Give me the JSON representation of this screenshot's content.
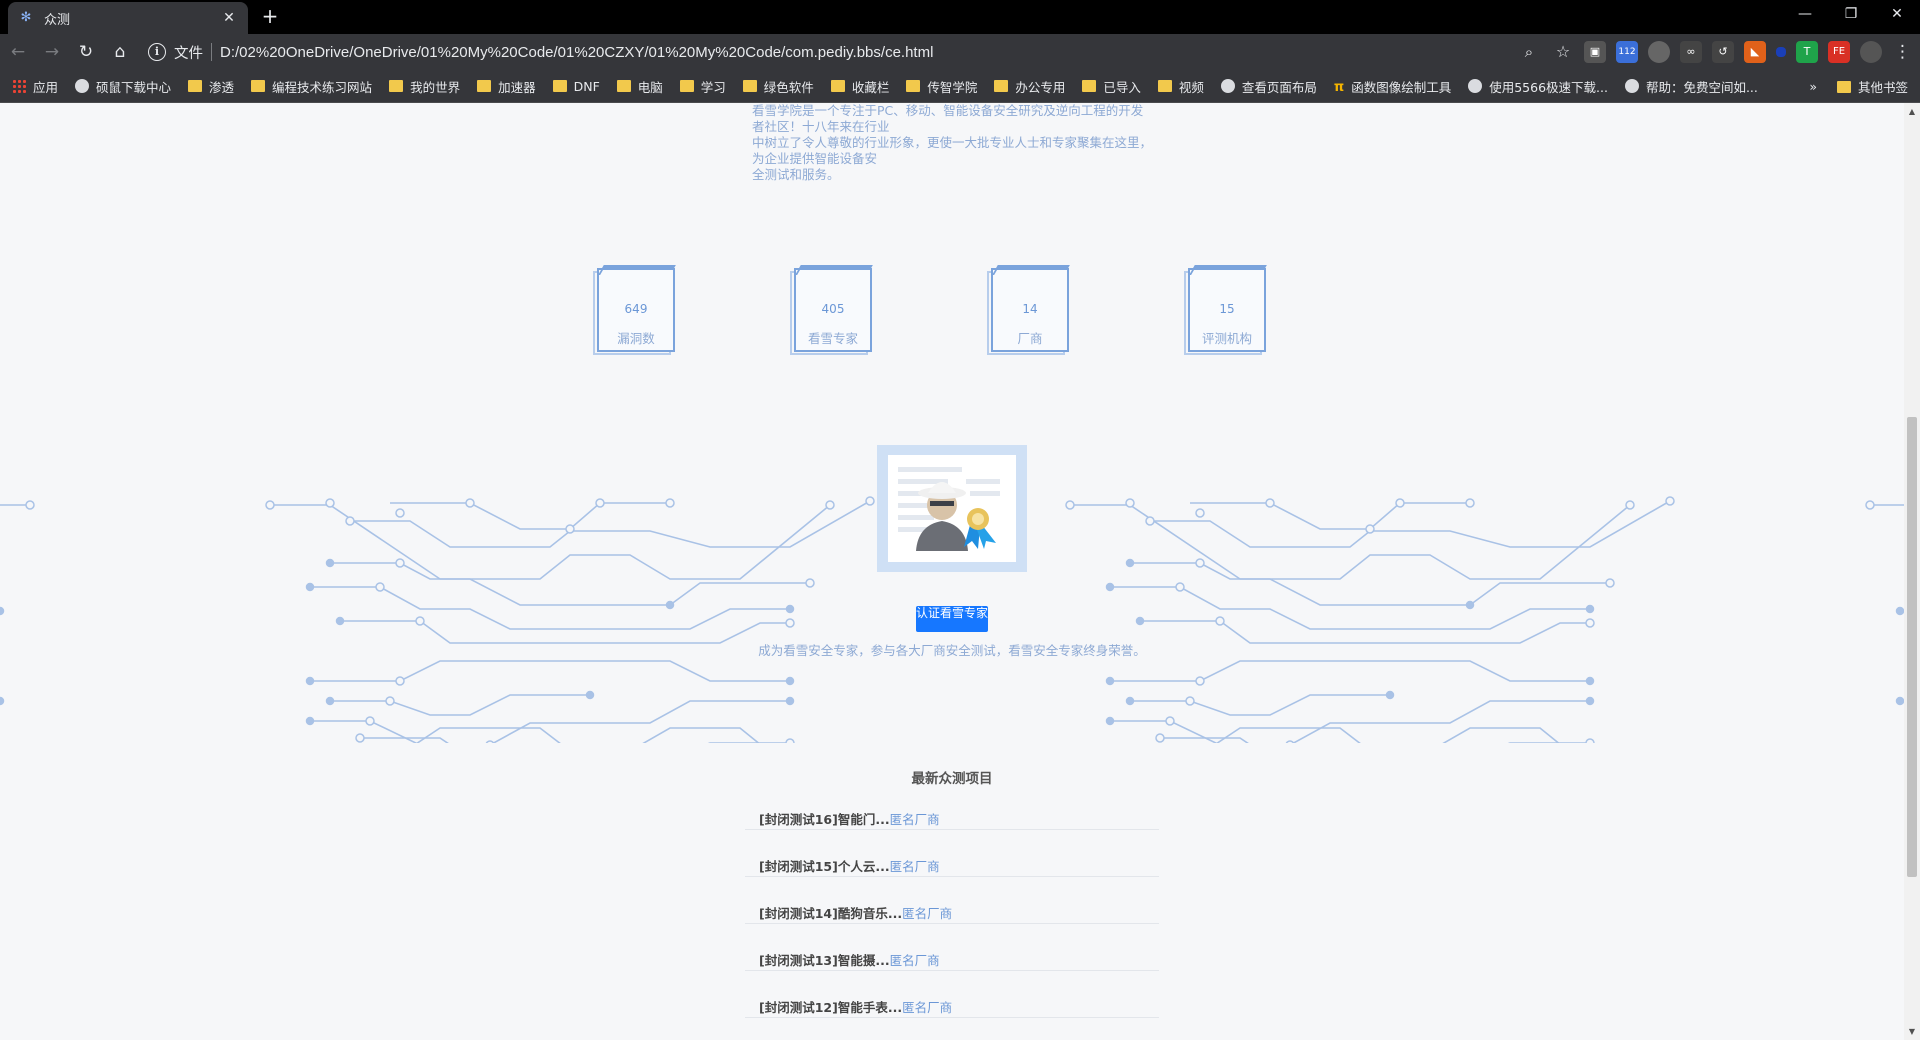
{
  "browser": {
    "tab_title": "众测",
    "scheme_label": "文件",
    "url": "D:/02%20OneDrive/OneDrive/01%20My%20Code/01%20CZXY/01%20My%20Code/com.pediy.bbs/ce.html",
    "extension_badge": "112",
    "ext_fe_label": "FE"
  },
  "bookmarks": [
    {
      "label": "应用",
      "icon": "apps-icon"
    },
    {
      "label": "硕鼠下载中心",
      "icon": "globe-icon"
    },
    {
      "label": "渗透",
      "icon": "folder-icon"
    },
    {
      "label": "编程技术练习网站",
      "icon": "folder-icon"
    },
    {
      "label": "我的世界",
      "icon": "folder-icon"
    },
    {
      "label": "加速器",
      "icon": "folder-icon"
    },
    {
      "label": "DNF",
      "icon": "folder-icon"
    },
    {
      "label": "电脑",
      "icon": "folder-icon"
    },
    {
      "label": "学习",
      "icon": "folder-icon"
    },
    {
      "label": "绿色软件",
      "icon": "folder-icon"
    },
    {
      "label": "收藏栏",
      "icon": "folder-icon"
    },
    {
      "label": "传智学院",
      "icon": "folder-icon"
    },
    {
      "label": "办公专用",
      "icon": "folder-icon"
    },
    {
      "label": "已导入",
      "icon": "folder-icon"
    },
    {
      "label": "视频",
      "icon": "folder-icon"
    },
    {
      "label": "查看页面布局",
      "icon": "globe-icon"
    },
    {
      "label": "函数图像绘制工具",
      "icon": "pi-icon"
    },
    {
      "label": "使用5566极速下载...",
      "icon": "globe-icon"
    },
    {
      "label": "帮助：免费空间如...",
      "icon": "globe-icon"
    }
  ],
  "bookmarks_overflow": "»",
  "bookmarks_other": "其他书签",
  "intro": {
    "line1": "看雪学院是一个专注于PC、移动、智能设备安全研究及逆向工程的开发者社区！十八年来在行业",
    "line2": "中树立了令人尊敬的行业形象，更使一大批专业人士和专家聚集在这里，为企业提供智能设备安",
    "line3": "全测试和服务。"
  },
  "stats": [
    {
      "value": "649",
      "label": "漏洞数"
    },
    {
      "value": "405",
      "label": "看雪专家"
    },
    {
      "value": "14",
      "label": "厂商"
    },
    {
      "value": "15",
      "label": "评测机构"
    }
  ],
  "cert": {
    "button_label": "认证看雪专家",
    "description": "成为看雪安全专家，参与各大厂商安全测试，看雪安全专家终身荣誉。"
  },
  "projects": {
    "title": "最新众测项目",
    "items": [
      {
        "name": "[封闭测试16]智能门...",
        "vendor": "匿名厂商"
      },
      {
        "name": "[封闭测试15]个人云...",
        "vendor": "匿名厂商"
      },
      {
        "name": "[封闭测试14]酷狗音乐...",
        "vendor": "匿名厂商"
      },
      {
        "name": "[封闭测试13]智能摄...",
        "vendor": "匿名厂商"
      },
      {
        "name": "[封闭测试12]智能手表...",
        "vendor": "匿名厂商"
      }
    ]
  },
  "colors": {
    "accent": "#1677ff",
    "text_light": "#8da9d4",
    "circuit": "#a9c2e6"
  }
}
